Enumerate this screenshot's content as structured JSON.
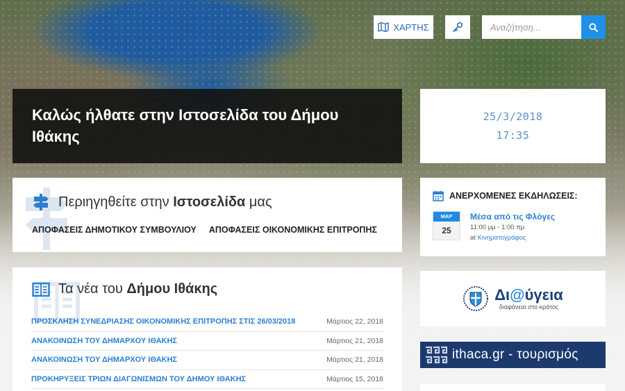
{
  "header": {
    "map_label": "ΧΑΡΤΗΣ",
    "search_placeholder": "Αναζήτηση..."
  },
  "welcome": {
    "title": "Καλώς ήλθατε στην Ιστοσελίδα του Δήμου Ιθάκης"
  },
  "datetime": {
    "date": "25/3/2018",
    "time": "17:35"
  },
  "navigate": {
    "heading_prefix": "Περιηγηθείτε στην",
    "heading_bold": "Ιστοσελίδα",
    "heading_suffix": "μας",
    "links": [
      "ΑΠΟΦΑΣΕΙΣ ΔΗΜΟΤΙΚΟΥ ΣΥΜΒΟΥΛΙΟΥ",
      "ΑΠΟΦΑΣΕΙΣ ΟΙΚΟΝΟΜΙΚΗΣ ΕΠΙΤΡΟΠΗΣ"
    ]
  },
  "news": {
    "heading_prefix": "Τα νέα του",
    "heading_bold": "Δήμου Ιθάκης",
    "items": [
      {
        "title": "ΠΡΟΣΚΛΗΣΗ ΣΥΝΕΔΡΙΑΣΗΣ ΟΙΚΟΝΟΜΙΚΗΣ ΕΠΙΤΡΟΠΗΣ ΣΤΙΣ 26/03/2018",
        "date": "Μάρτιος 22, 2018"
      },
      {
        "title": "ΑΝΑΚΟΙΝΩΣΗ ΤΟΥ ΔΗΜΑΡΧΟΥ ΙΘΑΚΗΣ",
        "date": "Μάρτιος 21, 2018"
      },
      {
        "title": "ΑΝΑΚΟΙΝΩΣΗ ΤΟΥ ΔΗΜΑΡΧΟΥ ΙΘΑΚΗΣ",
        "date": "Μάρτιος 21, 2018"
      },
      {
        "title": "ΠΡΟΚΗΡΥΞΕΙΣ ΤΡΙΩΝ ΔΙΑΓΩΝΙΣΜΩΝ ΤΟΥ ΔΗΜΟΥ ΙΘΑΚΗΣ",
        "date": "Μάρτιος 15, 2018"
      }
    ]
  },
  "events": {
    "heading": "ΑΝΕΡΧΟΜΕΝΕΣ ΕΚΔΗΛΩΣΕΙΣ:",
    "items": [
      {
        "month": "ΜΑΡ",
        "day": "25",
        "title": "Μέσα από τις Φλόγες",
        "time": "11:00 μμ - 1:00 πμ",
        "at_label": "at",
        "location": "Κινηματογράφος"
      }
    ]
  },
  "diavgeia": {
    "title_prefix": "Δι",
    "title_at": "@",
    "title_suffix": "ύγεια",
    "subtitle": "διαφάνεια στο κράτος"
  },
  "ithaca": {
    "text": "ithaca.gr - τουρισμός"
  },
  "colors": {
    "accent": "#1e90e8",
    "link": "#2b7fd0",
    "banner_dark": "#0f0f0f",
    "ithaca_bg": "#1d3a6e"
  },
  "icons": {
    "map": "map-icon",
    "key": "key-icon",
    "search": "search-icon",
    "signpost": "signpost-icon",
    "book": "book-icon",
    "calendar": "calendar-icon",
    "emblem": "greek-emblem-icon",
    "meander": "meander-icon"
  }
}
